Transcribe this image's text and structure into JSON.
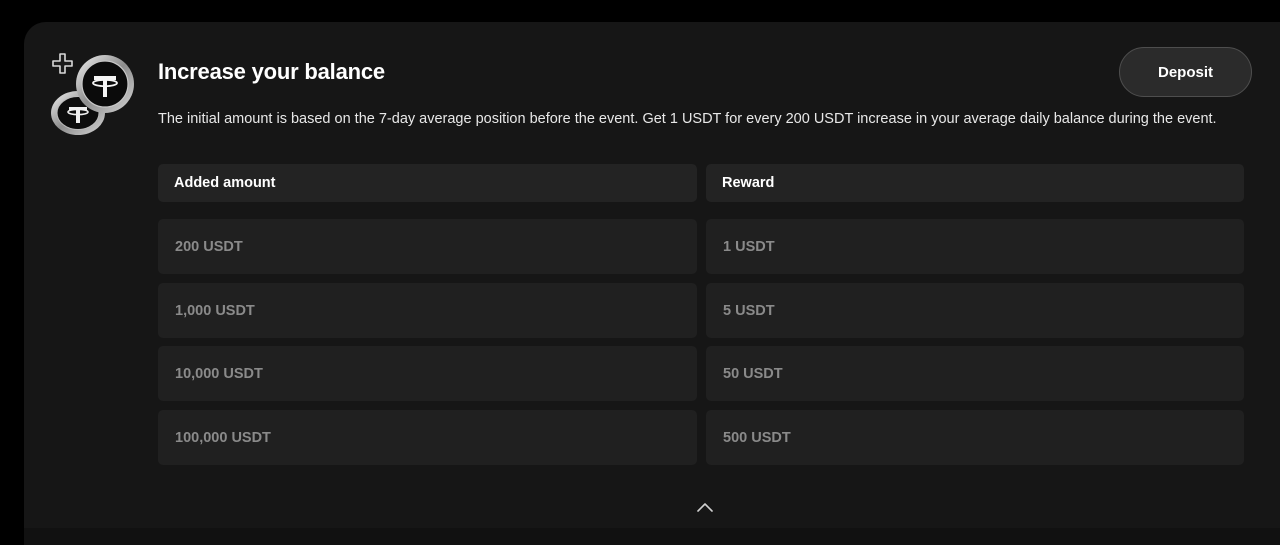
{
  "promo": {
    "title": "Increase your balance",
    "description": "The initial amount is based on the 7-day average position before the event. Get 1 USDT for every 200 USDT increase in your average daily balance during the event.",
    "deposit_label": "Deposit"
  },
  "table": {
    "headers": [
      "Added amount",
      "Reward"
    ],
    "rows": [
      [
        "200 USDT",
        "1 USDT"
      ],
      [
        "1,000 USDT",
        "5 USDT"
      ],
      [
        "10,000 USDT",
        "50 USDT"
      ],
      [
        "100,000 USDT",
        "500 USDT"
      ]
    ]
  },
  "icons": {
    "art": "usdt-coins-plus-icon",
    "collapse": "chevron-up-icon"
  },
  "colors": {
    "page_bg": "#000000",
    "card_bg": "#161616",
    "header_cell_bg": "#232323",
    "row_cell_bg": "#202020",
    "muted_text": "#8a8a8a"
  }
}
